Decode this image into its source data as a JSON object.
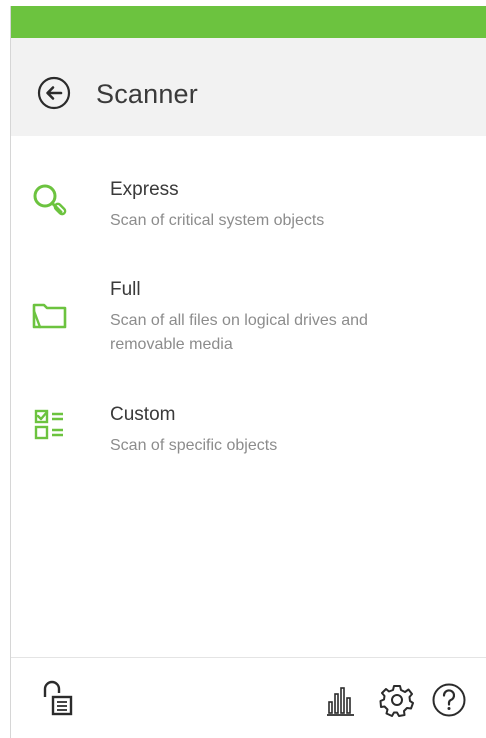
{
  "header": {
    "title": "Scanner",
    "back_icon": "arrow-left-circle-icon"
  },
  "colors": {
    "accent_green": "#6cc33f",
    "header_bg": "#f2f2f2",
    "description_gray": "#8c8c8c"
  },
  "scan_options": [
    {
      "name": "Express",
      "description": "Scan of critical system objects",
      "icon": "magnifier-icon"
    },
    {
      "name": "Full",
      "description": "Scan of all files on logical drives and removable media",
      "icon": "folder-icon"
    },
    {
      "name": "Custom",
      "description": "Scan of specific objects",
      "icon": "checklist-icon"
    }
  ],
  "footer": {
    "left_icon": "unlocked-padlock-icon",
    "right_icons": [
      "statistics-icon",
      "settings-gear-icon",
      "help-icon"
    ]
  }
}
